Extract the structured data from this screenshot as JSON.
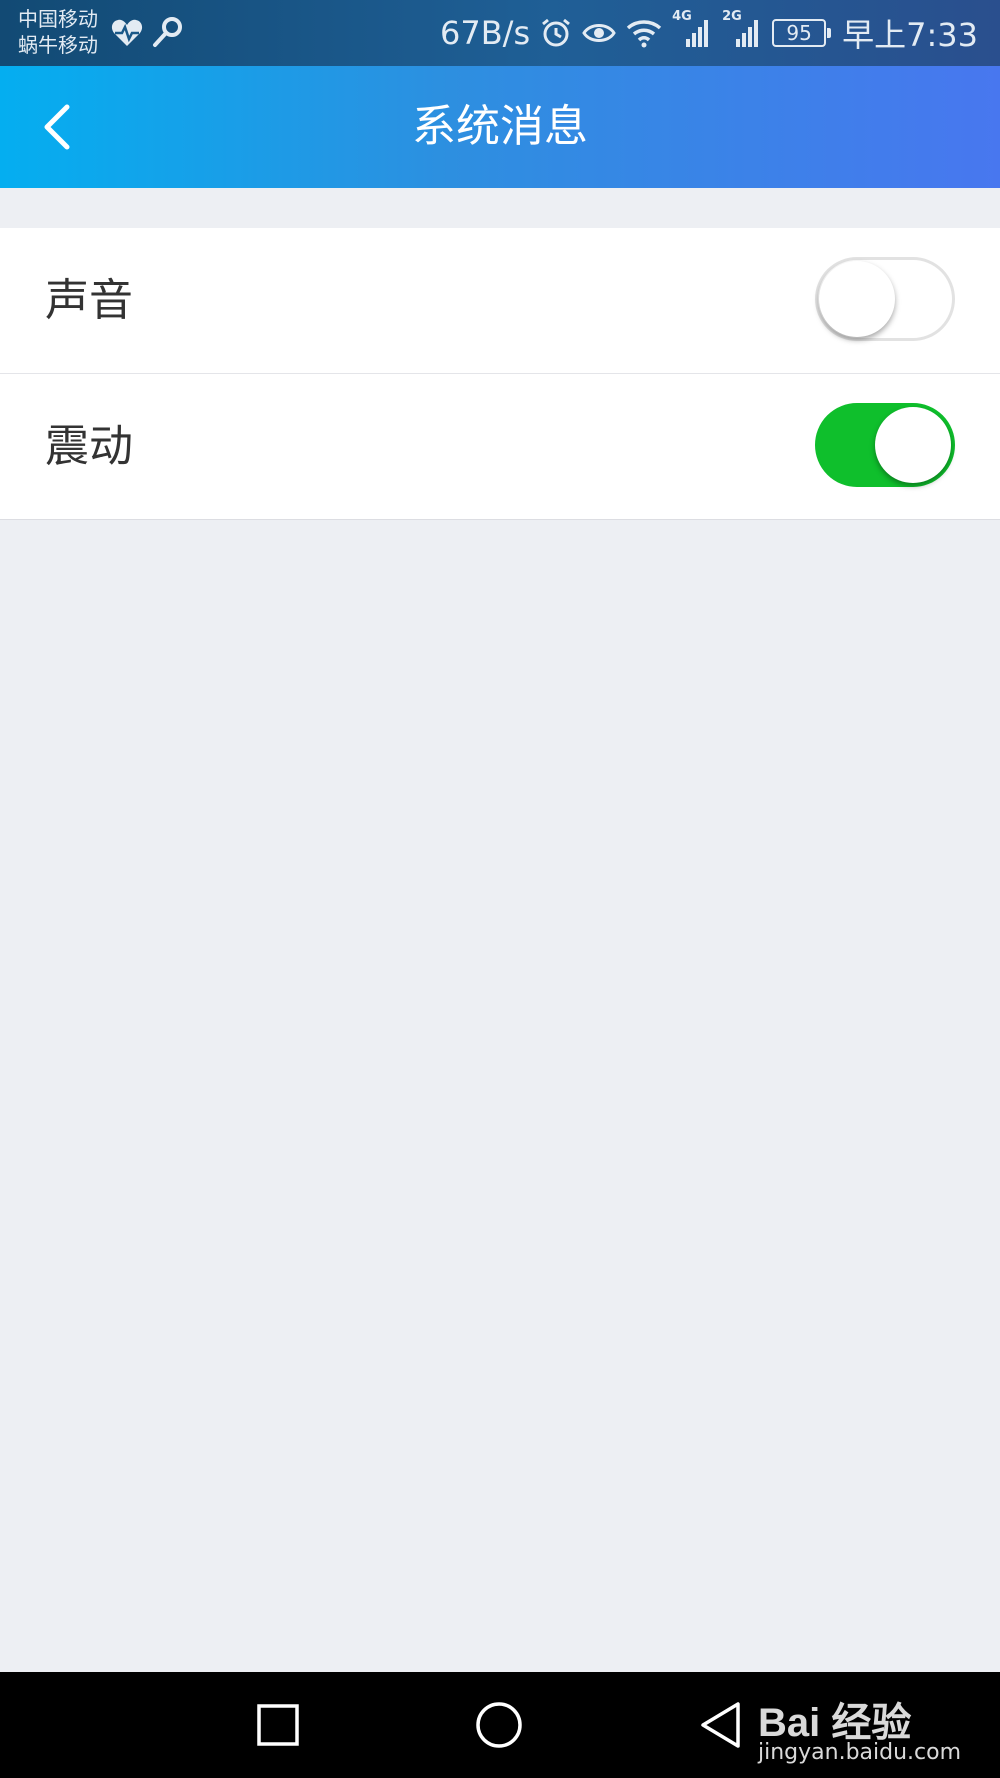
{
  "status_bar": {
    "carrier_1": "中国移动",
    "carrier_2": "蜗牛移动",
    "network_speed": "67B/s",
    "battery_level": "95",
    "time": "早上7:33",
    "signal_1_label": "4G",
    "signal_2_label": "2G",
    "icons": [
      "heart-rate-icon",
      "key-icon",
      "alarm-icon",
      "eye-icon",
      "wifi-icon",
      "signal-icon"
    ]
  },
  "header": {
    "title": "系统消息",
    "back_icon": "chevron-left-icon"
  },
  "settings": [
    {
      "label": "声音",
      "enabled": false
    },
    {
      "label": "震动",
      "enabled": true
    }
  ],
  "colors": {
    "toggle_on": "#0fbf2c",
    "toggle_off_border": "#e2e2e2",
    "header_gradient_start": "#04aef0",
    "header_gradient_end": "#4877ef",
    "page_background": "#edeff3"
  },
  "navigation": {
    "icons": [
      "square-icon",
      "circle-icon",
      "triangle-back-icon"
    ]
  },
  "watermark": {
    "logo": "Bai 经验",
    "url": "jingyan.baidu.com"
  }
}
